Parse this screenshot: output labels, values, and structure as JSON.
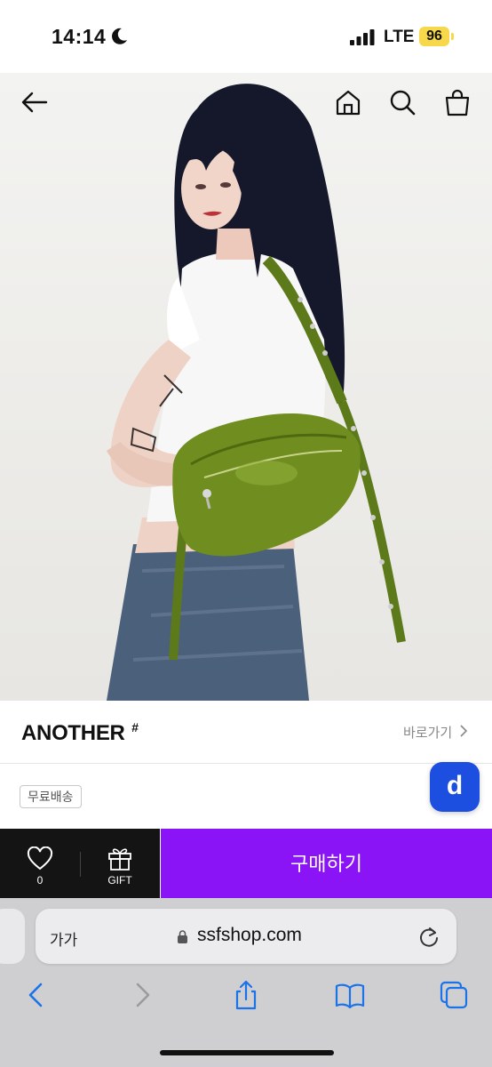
{
  "status": {
    "time": "14:14",
    "network": "LTE",
    "battery": "96"
  },
  "product": {
    "header_icons": [
      "back-arrow-icon",
      "home-icon",
      "search-icon",
      "shopping-bag-icon"
    ],
    "brand": "ANOTHER",
    "brand_mark": "#",
    "brand_link": "바로가기",
    "badge": "무료배송",
    "app_button": "d"
  },
  "purchase_bar": {
    "wish_count": "0",
    "gift_label": "GIFT",
    "buy_label": "구매하기",
    "buy_color": "#8a14f6"
  },
  "browser": {
    "text_size": "가가",
    "url": "ssfshop.com",
    "toolbar_icons": [
      "back-icon",
      "forward-icon",
      "share-icon",
      "bookmarks-icon",
      "tabs-icon"
    ]
  }
}
